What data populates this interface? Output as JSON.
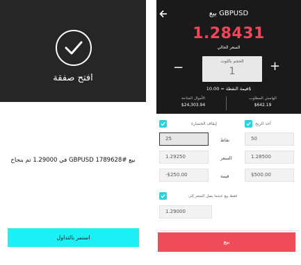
{
  "left": {
    "title": "افتح صفقة",
    "message": "في 1.29000 تم بنجاح GBPUSD بيع #1789628",
    "continue_label": "استمر بالتداول"
  },
  "right": {
    "header": {
      "pair_title": "بيع GBPUSD",
      "price": "1.28431",
      "price_label": "السعر الحالي",
      "volume_label": "الحجم باللوت",
      "volume_value": "1",
      "point_value": "قيمة النقطة = 10.00$",
      "free_funds_label": "الأموال المتاحة",
      "free_funds_value": "$24,303.94",
      "margin_label": "الهامش المطلوب",
      "margin_value": "$642.19"
    },
    "form": {
      "stop_loss_label": "إيقاف الخسارة",
      "take_profit_label": "أخذ الربح",
      "row_points_label": "نقاط",
      "row_price_label": "السعر",
      "row_value_label": "قيمة",
      "sl_points": "25",
      "sl_price": "1.29250",
      "sl_value": "-$250.00",
      "tp_points": "50",
      "tp_price": "1.28500",
      "tp_value": "$500.00",
      "limit_label": "فقط بيع عندما يصل السعر إلى",
      "limit_price": "1.29000",
      "sell_label": "بيع"
    }
  },
  "colors": {
    "accent_cyan": "#1cf0f4",
    "checkbox": "#2bd3e0",
    "sell_red": "#ef4d5a",
    "price_red": "#f0485a",
    "dark_header": "#1a1a1a"
  }
}
